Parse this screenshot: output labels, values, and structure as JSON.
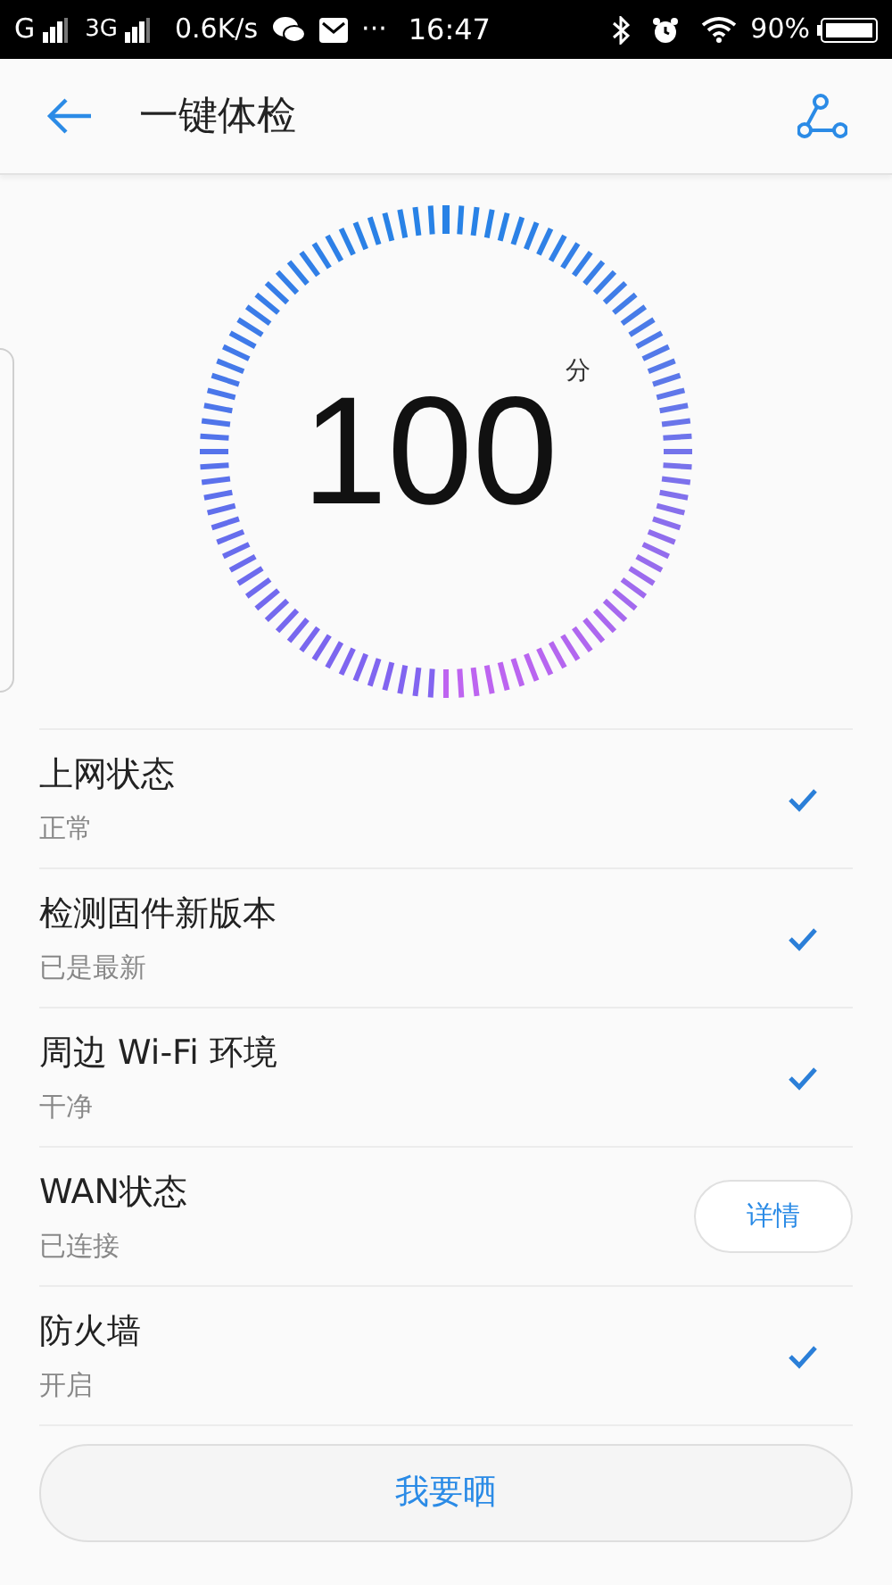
{
  "status_bar": {
    "carrier_1": "G",
    "carrier_2": "3G",
    "speed": "0.6K/s",
    "more": "···",
    "time": "16:47",
    "battery": "90%"
  },
  "header": {
    "title": "一键体检"
  },
  "score": {
    "value": "100",
    "unit": "分"
  },
  "checks": [
    {
      "kind": "check",
      "title": "上网状态",
      "status": "正常"
    },
    {
      "kind": "check",
      "title": "检测固件新版本",
      "status": "已是最新"
    },
    {
      "kind": "check",
      "title": "周边 Wi-Fi 环境",
      "status": "干净"
    },
    {
      "kind": "button",
      "title": "WAN状态",
      "status": "已连接",
      "action": "详情"
    },
    {
      "kind": "check",
      "title": "防火墙",
      "status": "开启"
    }
  ],
  "share_button": "我要晒"
}
